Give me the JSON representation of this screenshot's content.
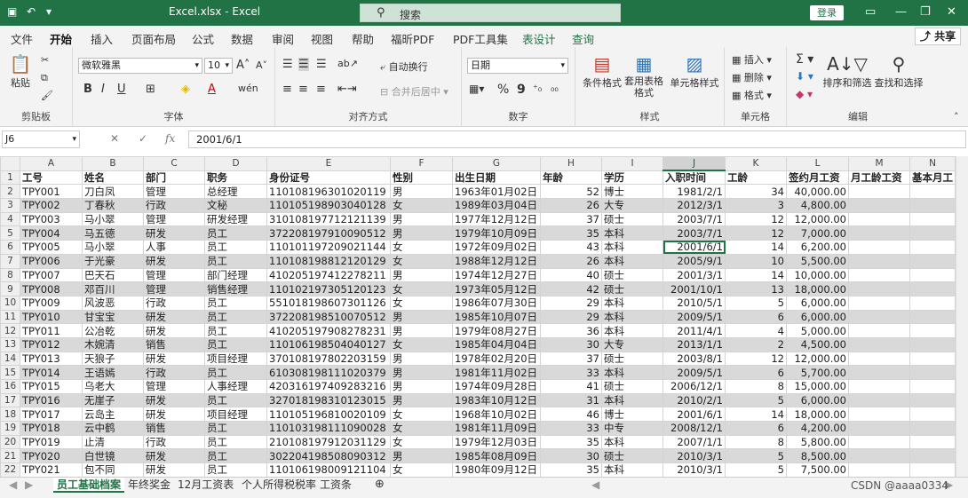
{
  "window": {
    "title": "Excel.xlsx  -  Excel",
    "search_placeholder": "搜索",
    "login": "登录",
    "share": "共享"
  },
  "ribbon_tabs": [
    "文件",
    "开始",
    "插入",
    "页面布局",
    "公式",
    "数据",
    "审阅",
    "视图",
    "帮助",
    "福昕PDF",
    "PDF工具集",
    "表设计",
    "查询"
  ],
  "ribbon": {
    "clipboard": {
      "paste": "粘贴",
      "label": "剪贴板"
    },
    "font": {
      "name": "微软雅黑",
      "size": "10",
      "label": "字体"
    },
    "align": {
      "wrap": "自动换行",
      "merge": "合并后居中",
      "label": "对齐方式"
    },
    "number": {
      "format": "日期",
      "label": "数字"
    },
    "styles": {
      "cond": "条件格式",
      "table": "套用表格格式",
      "cell": "单元格样式",
      "label": "样式"
    },
    "cells": {
      "insert": "插入",
      "delete": "删除",
      "format": "格式",
      "label": "单元格"
    },
    "edit": {
      "sort": "排序和筛选",
      "find": "查找和选择",
      "label": "编辑"
    }
  },
  "formula_bar": {
    "cell": "J6",
    "value": "2001/6/1"
  },
  "columns": [
    "A",
    "B",
    "C",
    "D",
    "E",
    "F",
    "G",
    "H",
    "I",
    "J",
    "K",
    "L",
    "M",
    "N"
  ],
  "selected_col": "J",
  "headers": [
    "工号",
    "姓名",
    "部门",
    "职务",
    "身份证号",
    "性别",
    "出生日期",
    "年龄",
    "学历",
    "入职时间",
    "工龄",
    "签约月工资",
    "月工龄工资",
    "基本月工"
  ],
  "rows": [
    [
      "TPY001",
      "刀白凤",
      "管理",
      "总经理",
      "110108196301020119",
      "男",
      "1963年01月02日",
      "52",
      "博士",
      "1981/2/1",
      "34",
      "40,000.00"
    ],
    [
      "TPY002",
      "丁春秋",
      "行政",
      "文秘",
      "110105198903040128",
      "女",
      "1989年03月04日",
      "26",
      "大专",
      "2012/3/1",
      "3",
      "4,800.00"
    ],
    [
      "TPY003",
      "马小翠",
      "管理",
      "研发经理",
      "310108197712121139",
      "男",
      "1977年12月12日",
      "37",
      "硕士",
      "2003/7/1",
      "12",
      "12,000.00"
    ],
    [
      "TPY004",
      "马五德",
      "研发",
      "员工",
      "372208197910090512",
      "男",
      "1979年10月09日",
      "35",
      "本科",
      "2003/7/1",
      "12",
      "7,000.00"
    ],
    [
      "TPY005",
      "马小翠",
      "人事",
      "员工",
      "110101197209021144",
      "女",
      "1972年09月02日",
      "43",
      "本科",
      "2001/6/1",
      "14",
      "6,200.00"
    ],
    [
      "TPY006",
      "于光豪",
      "研发",
      "员工",
      "110108198812120129",
      "女",
      "1988年12月12日",
      "26",
      "本科",
      "2005/9/1",
      "10",
      "5,500.00"
    ],
    [
      "TPY007",
      "巴天石",
      "管理",
      "部门经理",
      "410205197412278211",
      "男",
      "1974年12月27日",
      "40",
      "硕士",
      "2001/3/1",
      "14",
      "10,000.00"
    ],
    [
      "TPY008",
      "邓百川",
      "管理",
      "销售经理",
      "110102197305120123",
      "女",
      "1973年05月12日",
      "42",
      "硕士",
      "2001/10/1",
      "13",
      "18,000.00"
    ],
    [
      "TPY009",
      "风波恶",
      "行政",
      "员工",
      "551018198607301126",
      "女",
      "1986年07月30日",
      "29",
      "本科",
      "2010/5/1",
      "5",
      "6,000.00"
    ],
    [
      "TPY010",
      "甘宝宝",
      "研发",
      "员工",
      "372208198510070512",
      "男",
      "1985年10月07日",
      "29",
      "本科",
      "2009/5/1",
      "6",
      "6,000.00"
    ],
    [
      "TPY011",
      "公冶乾",
      "研发",
      "员工",
      "410205197908278231",
      "男",
      "1979年08月27日",
      "36",
      "本科",
      "2011/4/1",
      "4",
      "5,000.00"
    ],
    [
      "TPY012",
      "木婉清",
      "销售",
      "员工",
      "110106198504040127",
      "女",
      "1985年04月04日",
      "30",
      "大专",
      "2013/1/1",
      "2",
      "4,500.00"
    ],
    [
      "TPY013",
      "天狼子",
      "研发",
      "项目经理",
      "370108197802203159",
      "男",
      "1978年02月20日",
      "37",
      "硕士",
      "2003/8/1",
      "12",
      "12,000.00"
    ],
    [
      "TPY014",
      "王语嫣",
      "行政",
      "员工",
      "610308198111020379",
      "男",
      "1981年11月02日",
      "33",
      "本科",
      "2009/5/1",
      "6",
      "5,700.00"
    ],
    [
      "TPY015",
      "乌老大",
      "管理",
      "人事经理",
      "420316197409283216",
      "男",
      "1974年09月28日",
      "41",
      "硕士",
      "2006/12/1",
      "8",
      "15,000.00"
    ],
    [
      "TPY016",
      "无崖子",
      "研发",
      "员工",
      "327018198310123015",
      "男",
      "1983年10月12日",
      "31",
      "本科",
      "2010/2/1",
      "5",
      "6,000.00"
    ],
    [
      "TPY017",
      "云岛主",
      "研发",
      "项目经理",
      "110105196810020109",
      "女",
      "1968年10月02日",
      "46",
      "博士",
      "2001/6/1",
      "14",
      "18,000.00"
    ],
    [
      "TPY018",
      "云中鹤",
      "销售",
      "员工",
      "110103198111090028",
      "女",
      "1981年11月09日",
      "33",
      "中专",
      "2008/12/1",
      "6",
      "4,200.00"
    ],
    [
      "TPY019",
      "止清",
      "行政",
      "员工",
      "210108197912031129",
      "女",
      "1979年12月03日",
      "35",
      "本科",
      "2007/1/1",
      "8",
      "5,800.00"
    ],
    [
      "TPY020",
      "白世镜",
      "研发",
      "员工",
      "302204198508090312",
      "男",
      "1985年08月09日",
      "30",
      "硕士",
      "2010/3/1",
      "5",
      "8,500.00"
    ],
    [
      "TPY021",
      "包不同",
      "研发",
      "员工",
      "110106198009121104",
      "女",
      "1980年09月12日",
      "35",
      "本科",
      "2010/3/1",
      "5",
      "7,500.00"
    ]
  ],
  "current_row_index": 4,
  "current_col_index": 9,
  "sheets": [
    "员工基础档案",
    "年终奖金",
    "12月工资表",
    "个人所得税税率",
    "工资条"
  ],
  "active_sheet": "员工基础档案",
  "watermark": "CSDN @aaaa0334"
}
